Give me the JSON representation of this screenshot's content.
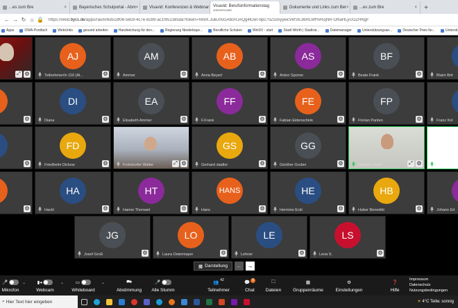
{
  "browser": {
    "tabs": [
      {
        "label": "...es zum Bre",
        "active": false
      },
      {
        "label": "Bayerisches Schulportal - Abm",
        "active": false
      },
      {
        "label": "Visavid: Konferenzen & Webinar",
        "active": false
      },
      {
        "label": "Visavid: Berufsinformationstag",
        "sub": "WIEDERGABE",
        "active": true
      },
      {
        "label": "Dokumente und Links zum Ber",
        "active": false
      },
      {
        "label": "...es zum Bre",
        "active": false
      }
    ],
    "new_tab": "+",
    "url_prefix": "https://vikid.",
    "url_domain": "bycs.de",
    "url_rest": "/apps/raum/6d51df06-58c9-4c7e-8289-ac1f951385da?token=X69X.JuBJ0sGAbcRJAQg4lOwTbpc70Z53vyyeicVkfVE36HC6ff%RojNR-ONaHLyUOZHNgF",
    "bookmarks": [
      "Apps",
      "OWA-Postfach",
      "WebUntis",
      "gesund arbeiten",
      "Handreichung für den...",
      "Regierung Niederbaye...",
      "Berufliche Schulen",
      "WinSV - start",
      "Stadt Wörth | Stadtrat...",
      "Dateimanager",
      "Unterstützungsan...",
      "Deutscher Preis für...",
      "Unterstützungsangeb..."
    ]
  },
  "participants": [
    {
      "initials": "",
      "name": "",
      "color": "",
      "video": "red"
    },
    {
      "initials": "AJ",
      "name": "Teilnehmer/in 116 (Al...",
      "color": "#e8611c"
    },
    {
      "initials": "AM",
      "name": "Ammer",
      "color": "#4a4f55"
    },
    {
      "initials": "AB",
      "name": "Anna Beyerl",
      "color": "#e8611c"
    },
    {
      "initials": "AS",
      "name": "Anton Sporrer",
      "color": "#8b2a9b"
    },
    {
      "initials": "BF",
      "name": "Beate Frank",
      "color": "#4a4f55"
    },
    {
      "initials": "BH",
      "name": "Blaim Brit",
      "color": "#2a4e82"
    },
    {
      "initials": "",
      "name": "",
      "color": "#e8611c"
    },
    {
      "initials": "DI",
      "name": "Diana",
      "color": "#2a4e82"
    },
    {
      "initials": "EA",
      "name": "Elisabeth Ammer",
      "color": "#4a4f55"
    },
    {
      "initials": "FF",
      "name": "F.Frank",
      "color": "#8b2a9b"
    },
    {
      "initials": "FE",
      "name": "Fabian Eidenschink",
      "color": "#e8611c"
    },
    {
      "initials": "FP",
      "name": "Florian Panten",
      "color": "#4a4f55"
    },
    {
      "initials": "FK",
      "name": "Franz Kol",
      "color": "#2a4e82"
    },
    {
      "initials": "",
      "name": "r",
      "color": "#2a4e82"
    },
    {
      "initials": "FD",
      "name": "Friedhelm Dickow",
      "color": "#e8a80e"
    },
    {
      "initials": "",
      "name": "Fruhstorfer Walter",
      "color": "",
      "video": "room"
    },
    {
      "initials": "GS",
      "name": "Gerhard stadler",
      "color": "#e8a80e"
    },
    {
      "initials": "GG",
      "name": "Günther Gruber",
      "color": "#4a4f55"
    },
    {
      "initials": "",
      "name": "Günster Josef",
      "color": "",
      "video": "wall"
    },
    {
      "initials": "",
      "name": "",
      "color": "",
      "video": "screen"
    },
    {
      "initials": "",
      "name": "",
      "color": "#e8611c"
    },
    {
      "initials": "HA",
      "name": "Hackl",
      "color": "#2a4e82"
    },
    {
      "initials": "HT",
      "name": "Hanne Thorwart",
      "color": "#8b2a9b"
    },
    {
      "initials": "HANS",
      "name": "Hans",
      "color": "#e8611c"
    },
    {
      "initials": "HE",
      "name": "Hermine Eckl",
      "color": "#2a4e82"
    },
    {
      "initials": "HB",
      "name": "Huber Benedikt",
      "color": "#e8a80e"
    },
    {
      "initials": "JE",
      "name": "Johann Ed",
      "color": "#8b2a9b"
    },
    {
      "initials": "JG",
      "name": "Josef Groß",
      "color": "#4a4f55"
    },
    {
      "initials": "LO",
      "name": "Laura Ostermayer",
      "color": "#e8611c"
    },
    {
      "initials": "LE",
      "name": "Lehner",
      "color": "#2a4e82"
    },
    {
      "initials": "LS",
      "name": "Lena S.",
      "color": "#c8102e"
    }
  ],
  "view_controls": {
    "label": "Darstellung",
    "prev": "←",
    "next": "→"
  },
  "toolbar": {
    "mikrofon": "Mikrofon",
    "webcam": "Webcam",
    "whiteboard": "Whiteboard",
    "abstimmung": "Abstimmung",
    "alle_stumm": "Alle Stumm",
    "teilnehmer": "Teilnehmer",
    "teilnehmer_count": "42",
    "chat": "Chat",
    "chat_count": "9",
    "dateien": "Dateien",
    "gruppenraeume": "Gruppenräume",
    "einstellungen": "Einstellungen",
    "hilfe": "Hilfe",
    "impressum": "Impressum",
    "datenschutz": "Datenschutz",
    "nutzungsbedingungen": "Nutzungsbedingungen"
  },
  "taskbar": {
    "search_placeholder": "Hier Text hier eingeben",
    "weather": "4°C  Teilw. sonnig"
  },
  "colors": {
    "accent_green": "#2bc45a",
    "orange": "#e8611c",
    "purple": "#8b2a9b",
    "navy": "#2a4e82",
    "gray": "#4a4f55",
    "amber": "#e8a80e",
    "red": "#c8102e"
  }
}
